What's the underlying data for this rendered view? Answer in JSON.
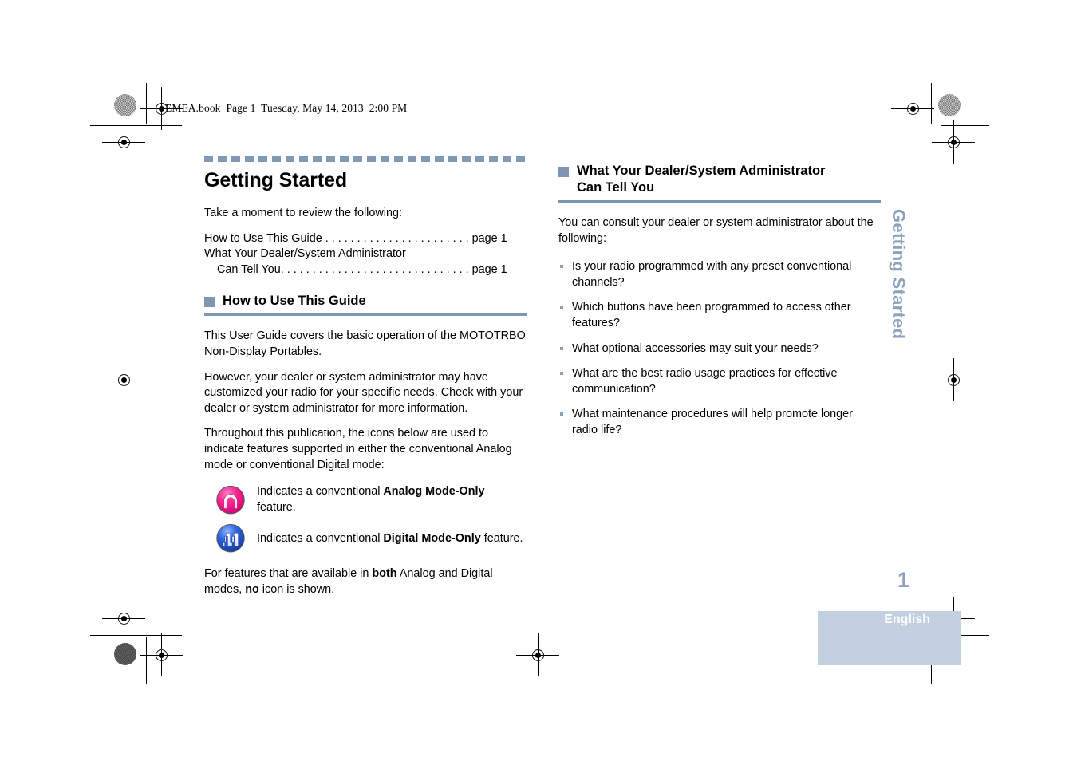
{
  "header": {
    "slug": "EMEA.book  Page 1  Tuesday, May 14, 2013  2:00 PM"
  },
  "left_column": {
    "chapter_title": "Getting Started",
    "intro": "Take a moment to review the following:",
    "toc": [
      {
        "label": "How to Use This Guide",
        "leader": " . . . . . . . . . . . . . . . . . . . . . . . ",
        "page": "page 1",
        "indent": false
      },
      {
        "label": "What Your Dealer/System Administrator",
        "leader": "",
        "page": "",
        "indent": false
      },
      {
        "label": "Can Tell You",
        "leader": ". . . . . . . . . . . . . . . . . . . . . . . . . . . . . . ",
        "page": "page 1",
        "indent": true
      }
    ],
    "section": {
      "heading": "How to Use This Guide",
      "paragraphs": [
        "This User Guide covers the basic operation of the MOTOTRBO Non-Display Portables.",
        "However, your dealer or system administrator may have customized your radio for your specific needs. Check with your dealer or system administrator for more information.",
        "Throughout this publication, the icons below are used to indicate features supported in either the conventional Analog mode or conventional Digital mode:"
      ],
      "icon_rows": [
        {
          "icon": "analog-mode-icon",
          "text_before": "Indicates a conventional ",
          "text_bold": "Analog Mode-Only",
          "text_after": " feature."
        },
        {
          "icon": "digital-mode-icon",
          "text_before": "Indicates a conventional ",
          "text_bold": "Digital Mode-Only",
          "text_after": " feature."
        }
      ],
      "closing": {
        "p1": "For features that are available in ",
        "b1": "both",
        "p2": " Analog and Digital modes, ",
        "b2": "no",
        "p3": " icon is shown."
      }
    }
  },
  "right_column": {
    "section": {
      "heading_line1": "What Your Dealer/System Administrator",
      "heading_line2": "Can Tell You",
      "intro": "You can consult your dealer or system administrator about the following:",
      "bullets": [
        "Is your radio programmed with any preset conventional channels?",
        "Which buttons have been programmed to access other features?",
        "What optional accessories may suit your needs?",
        "What are the best radio usage practices for effective communication?",
        "What maintenance procedures will help promote longer radio life?"
      ]
    }
  },
  "furniture": {
    "vertical_chapter_tab": "Getting Started",
    "page_number": "1",
    "language": "English"
  },
  "colors": {
    "accent_blue_gray": "#7e96b2",
    "tab_text": "#8ba1bc",
    "lang_box": "#c2d0e0",
    "analog_icon": "#ec2a86",
    "digital_icon": "#2a5fd6"
  }
}
